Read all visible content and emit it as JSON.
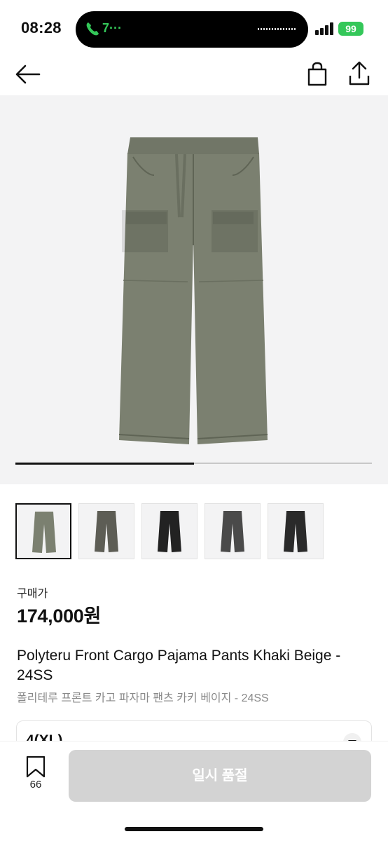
{
  "status_bar": {
    "time": "08:28",
    "call_label": "7···",
    "battery": "99"
  },
  "header": {
    "back_icon": "arrow-left-icon",
    "bag_icon": "shopping-bag-icon",
    "share_icon": "share-icon"
  },
  "gallery": {
    "progress": 0.5,
    "product_color": "#7b8070"
  },
  "thumbnails": [
    {
      "color": "#7b8070",
      "selected": true
    },
    {
      "color": "#5d5d55",
      "selected": false
    },
    {
      "color": "#222222",
      "selected": false
    },
    {
      "color": "#4a4a4a",
      "selected": false
    },
    {
      "color": "#2a2a2a",
      "selected": false
    }
  ],
  "product": {
    "price_label": "구매가",
    "price": "174,000원",
    "name_en": "Polyteru Front Cargo Pajama Pants Khaki Beige - 24SS",
    "name_ko": "폴리테루 프론트 카고 파자마 팬츠 카키 베이지 - 24SS"
  },
  "size_select": {
    "value": "4(XL)"
  },
  "bottom_bar": {
    "bookmark_count": "66",
    "action_label": "일시 품절"
  }
}
